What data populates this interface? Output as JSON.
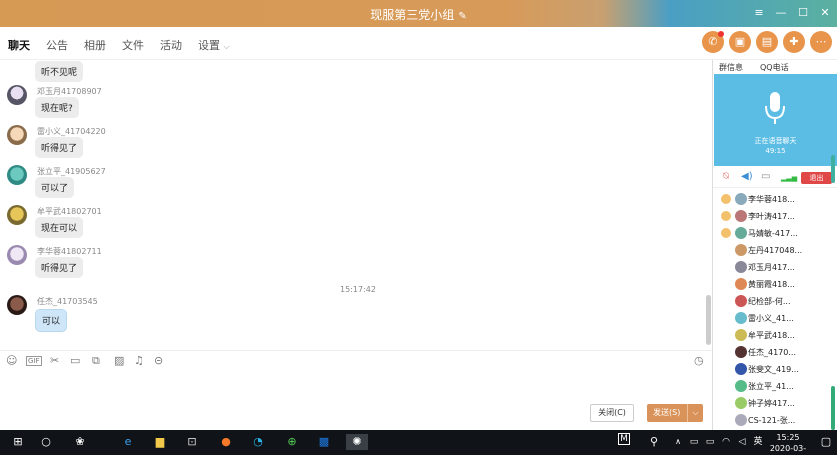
{
  "window": {
    "title": "现服第三党小组",
    "edit_icon": "pencil-icon"
  },
  "tabs": [
    {
      "label": "聊天",
      "active": true
    },
    {
      "label": "公告"
    },
    {
      "label": "相册"
    },
    {
      "label": "文件"
    },
    {
      "label": "活动"
    },
    {
      "label": "设置"
    }
  ],
  "messages": [
    {
      "sender": "",
      "text": "听不见呢"
    },
    {
      "sender": "邓玉月41708907",
      "text": "现在呢?"
    },
    {
      "sender": "雷小义_41704220",
      "text": "听得见了"
    },
    {
      "sender": "张立平_41905627",
      "text": "可以了"
    },
    {
      "sender": "牟平武41802701",
      "text": "现在可以"
    },
    {
      "sender": "李华蓉41802711",
      "text": "听得见了"
    },
    {
      "sender": "任杰_41703545",
      "text": "可以"
    }
  ],
  "timestamp": "15:17:42",
  "input": {
    "close_label": "关闭(C)",
    "send_label": "发送(S)"
  },
  "right_panel": {
    "tabs": [
      "群信息",
      "QQ电话"
    ],
    "voice_status": "正在语音聊天",
    "voice_time": "49:15",
    "exit_label": "退出",
    "members": [
      "李华蓉418...",
      "李叶涛417...",
      "马婧敏-417...",
      "左丹417048...",
      "邓玉月417...",
      "黄丽霞418...",
      "纪检部-何...",
      "雷小义_41...",
      "牟平武418...",
      "任杰_4170...",
      "张斐文_419...",
      "张立平_41...",
      "钟子婷417...",
      "CS-121-张..."
    ]
  },
  "taskbar": {
    "time": "15:25",
    "date": "2020-03-14",
    "ime": "M"
  }
}
